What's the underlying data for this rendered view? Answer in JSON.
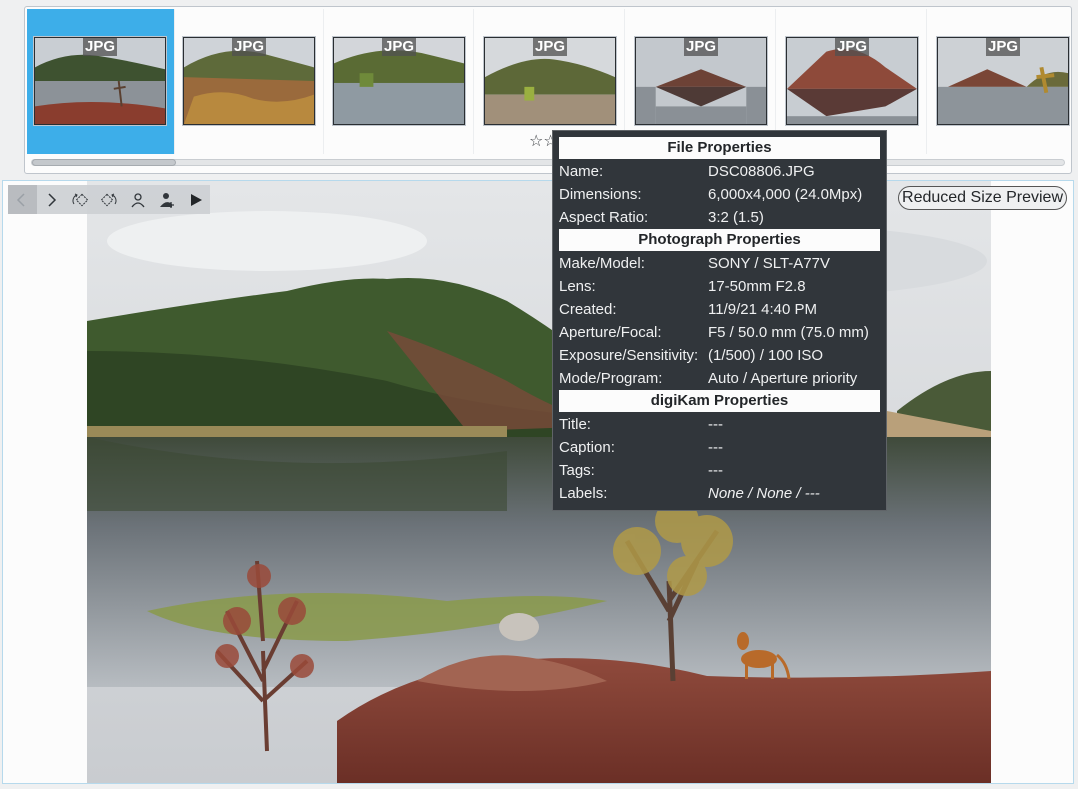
{
  "thumbnails": [
    {
      "badge": "JPG",
      "selected": true
    },
    {
      "badge": "JPG",
      "selected": false
    },
    {
      "badge": "JPG",
      "selected": false
    },
    {
      "badge": "JPG",
      "selected": false,
      "stars": "☆☆☆"
    },
    {
      "badge": "JPG",
      "selected": false
    },
    {
      "badge": "JPG",
      "selected": false
    },
    {
      "badge": "JPG",
      "selected": false
    }
  ],
  "accent_color": "#3daee9",
  "toolbar": {
    "icons": [
      "chevron-left-icon",
      "chevron-right-icon",
      "rotate-left-icon",
      "rotate-right-icon",
      "person-icon",
      "add-person-icon",
      "play-icon"
    ]
  },
  "reduced_size_label": "Reduced Size Preview",
  "tooltip": {
    "file_header": "File Properties",
    "file_rows": [
      {
        "key": "Name:",
        "value": "DSC08806.JPG"
      },
      {
        "key": "Dimensions:",
        "value": "6,000x4,000 (24.0Mpx)"
      },
      {
        "key": "Aspect Ratio:",
        "value": "3:2 (1.5)"
      }
    ],
    "photo_header": "Photograph Properties",
    "photo_rows": [
      {
        "key": "Make/Model:",
        "value": "SONY / SLT-A77V"
      },
      {
        "key": "Lens:",
        "value": "17-50mm F2.8"
      },
      {
        "key": "Created:",
        "value": "11/9/21 4:40 PM"
      },
      {
        "key": "Aperture/Focal:",
        "value": "F5 / 50.0 mm (75.0 mm)"
      },
      {
        "key": "Exposure/Sensitivity:",
        "value": "(1/500) / 100 ISO"
      },
      {
        "key": "Mode/Program:",
        "value": "Auto / Aperture priority"
      }
    ],
    "digikam_header": "digiKam Properties",
    "digikam_rows": [
      {
        "key": "Title:",
        "value": "---"
      },
      {
        "key": "Caption:",
        "value": "---"
      },
      {
        "key": "Tags:",
        "value": "---"
      },
      {
        "key": "Labels:",
        "value": "None / None / ---"
      }
    ]
  }
}
